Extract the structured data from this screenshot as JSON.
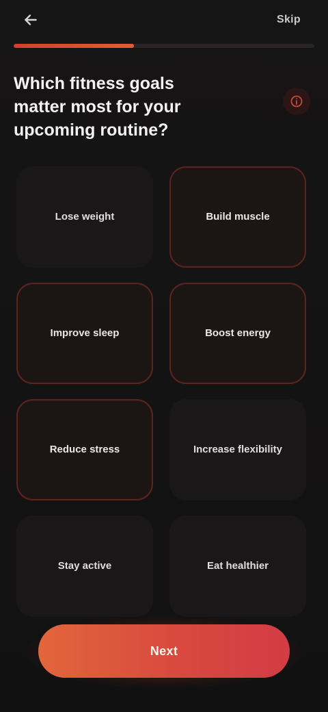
{
  "header": {
    "back_icon": "arrow-left-icon",
    "skip_label": "Skip"
  },
  "progress": {
    "fraction": 0.4,
    "accent": "#d2402f"
  },
  "main": {
    "headline": "Which fitness goals matter most for your upcoming routine?",
    "info_icon": "info-icon"
  },
  "options": [
    {
      "label": "Lose weight",
      "selected": false
    },
    {
      "label": "Build muscle",
      "selected": true
    },
    {
      "label": "Improve sleep",
      "selected": true
    },
    {
      "label": "Boost energy",
      "selected": true
    },
    {
      "label": "Reduce stress",
      "selected": true
    },
    {
      "label": "Increase flexibility",
      "selected": false
    },
    {
      "label": "Stay active",
      "selected": false
    },
    {
      "label": "Eat healthier",
      "selected": false
    }
  ],
  "cta": {
    "label": "Next"
  },
  "colors": {
    "background": "#141313",
    "card": "#191717",
    "selected_border": "#5a2420",
    "cta_start": "#e2663c",
    "cta_end": "#d13c45"
  }
}
